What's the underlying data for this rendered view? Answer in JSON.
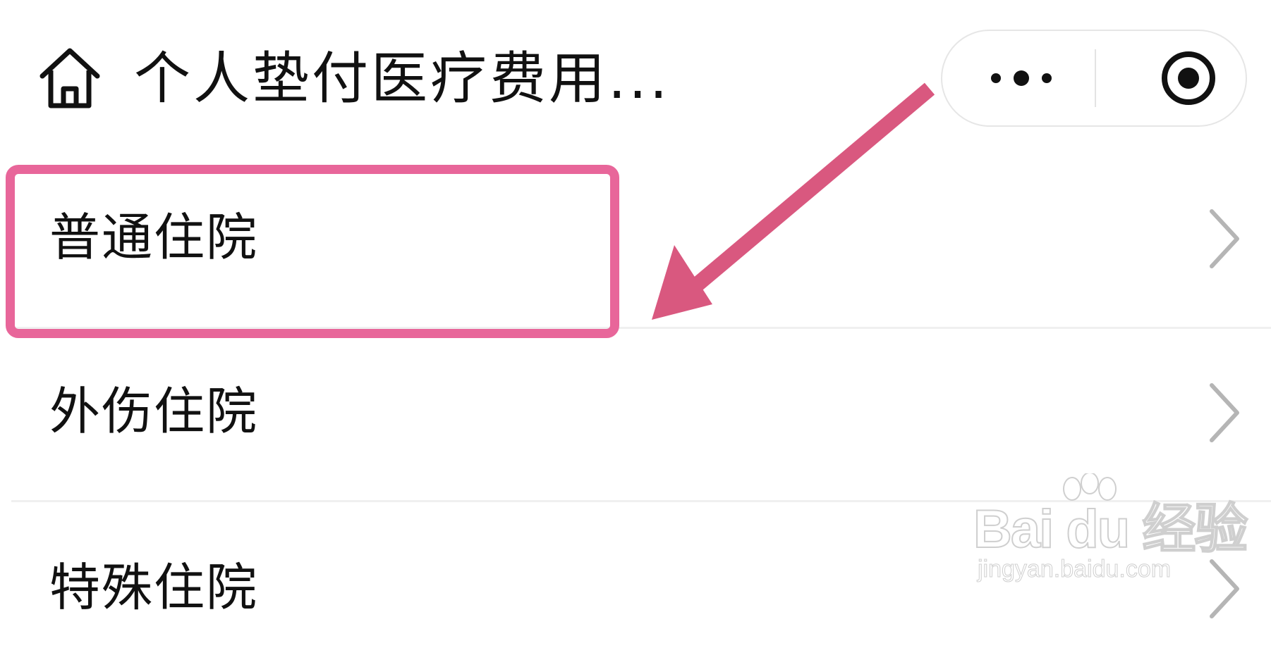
{
  "header": {
    "title": "个人垫付医疗费用...",
    "home_icon": "home-icon",
    "more_icon": "more-dots-icon",
    "close_icon": "miniprogram-close-icon"
  },
  "list": {
    "items": [
      {
        "label": "普通住院",
        "icon": "chevron-right-icon"
      },
      {
        "label": "外伤住院",
        "icon": "chevron-right-icon"
      },
      {
        "label": "特殊住院",
        "icon": "chevron-right-icon"
      }
    ]
  },
  "annotation": {
    "highlight_color": "#e8669a",
    "arrow_color": "#d9587f"
  },
  "watermark": {
    "brand": "Bai du 经验",
    "url": "jingyan.baidu.com"
  },
  "colors": {
    "text": "#111111",
    "chevron": "#b5b5b5",
    "separator": "#f0f0f0",
    "capsule_border": "#e6e6e6"
  }
}
